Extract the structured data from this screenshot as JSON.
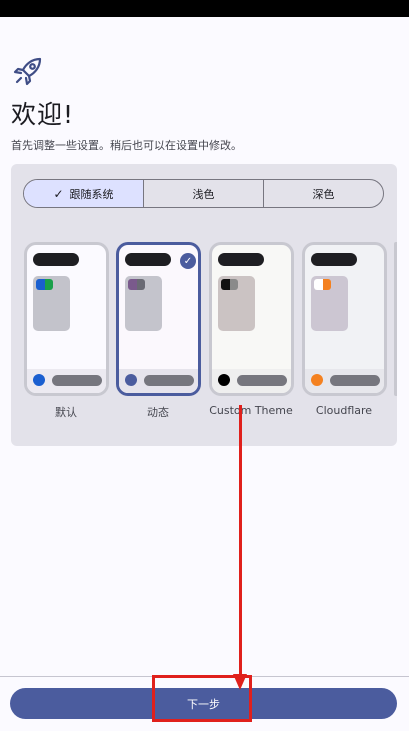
{
  "header": {
    "icon": "rocket-icon",
    "title": "欢迎!",
    "subtitle": "首先调整一些设置。稍后也可以在设置中修改。"
  },
  "mode_selector": {
    "options": [
      {
        "label": "跟随系统",
        "selected": true
      },
      {
        "label": "浅色",
        "selected": false
      },
      {
        "label": "深色",
        "selected": false
      }
    ]
  },
  "themes": [
    {
      "label": "默认",
      "selected": false,
      "bg": "#fbfaff",
      "card": "#c3c3cb",
      "swatch": [
        "#1a5fd0",
        "#1aa04a"
      ],
      "dot": "#1a5fd0",
      "bottom": "#eceaf1"
    },
    {
      "label": "动态",
      "selected": true,
      "bg": "#fbf8fd",
      "card": "#c4c4cc",
      "swatch": [
        "#7a5a8c",
        "#6a6a74"
      ],
      "dot": "#4b5c9e",
      "bottom": "#e6e4ec"
    },
    {
      "label": "Custom Theme",
      "selected": false,
      "bg": "#f8f8f6",
      "card": "#cbc3c3",
      "swatch": [
        "#111111",
        "#8a8a8a"
      ],
      "dot": "#000000",
      "bottom": "#efefef"
    },
    {
      "label": "Cloudflare",
      "selected": false,
      "bg": "#f1f2f5",
      "card": "#ccc6d2",
      "swatch": [
        "#ffffff",
        "#f48120"
      ],
      "dot": "#f48120",
      "bottom": "#e7e7ec"
    }
  ],
  "footer": {
    "next_label": "下一步"
  },
  "colors": {
    "primary": "#4b5c9e",
    "annotation": "#e0201c"
  }
}
